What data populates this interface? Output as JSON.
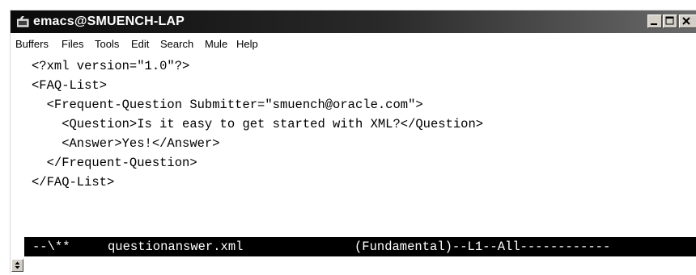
{
  "window": {
    "title": "emacs@SMUENCH-LAP",
    "buttons": [
      "minimize-icon",
      "maximize-icon",
      "close-icon"
    ]
  },
  "menubar": {
    "items": [
      "Buffers",
      "Files",
      "Tools",
      "Edit",
      "Search",
      "Mule",
      "Help"
    ]
  },
  "editor": {
    "lines": [
      "<?xml version=\"1.0\"?>",
      "<FAQ-List>",
      "  <Frequent-Question Submitter=\"smuench@oracle.com\">",
      "    <Question>Is it easy to get started with XML?</Question>",
      "    <Answer>Yes!</Answer>",
      "  </Frequent-Question>",
      "</FAQ-List>"
    ]
  },
  "modeline": {
    "status": "--\\**",
    "buffer_name": "questionanswer.xml",
    "mode_info": "(Fundamental)--L1--All------------"
  },
  "minibuffer": {
    "text": ""
  },
  "colors": {
    "titlebar": "#000000",
    "modeline_bg": "#000000",
    "modeline_fg": "#ffffff",
    "scrollbar": "#c8c8c8"
  }
}
